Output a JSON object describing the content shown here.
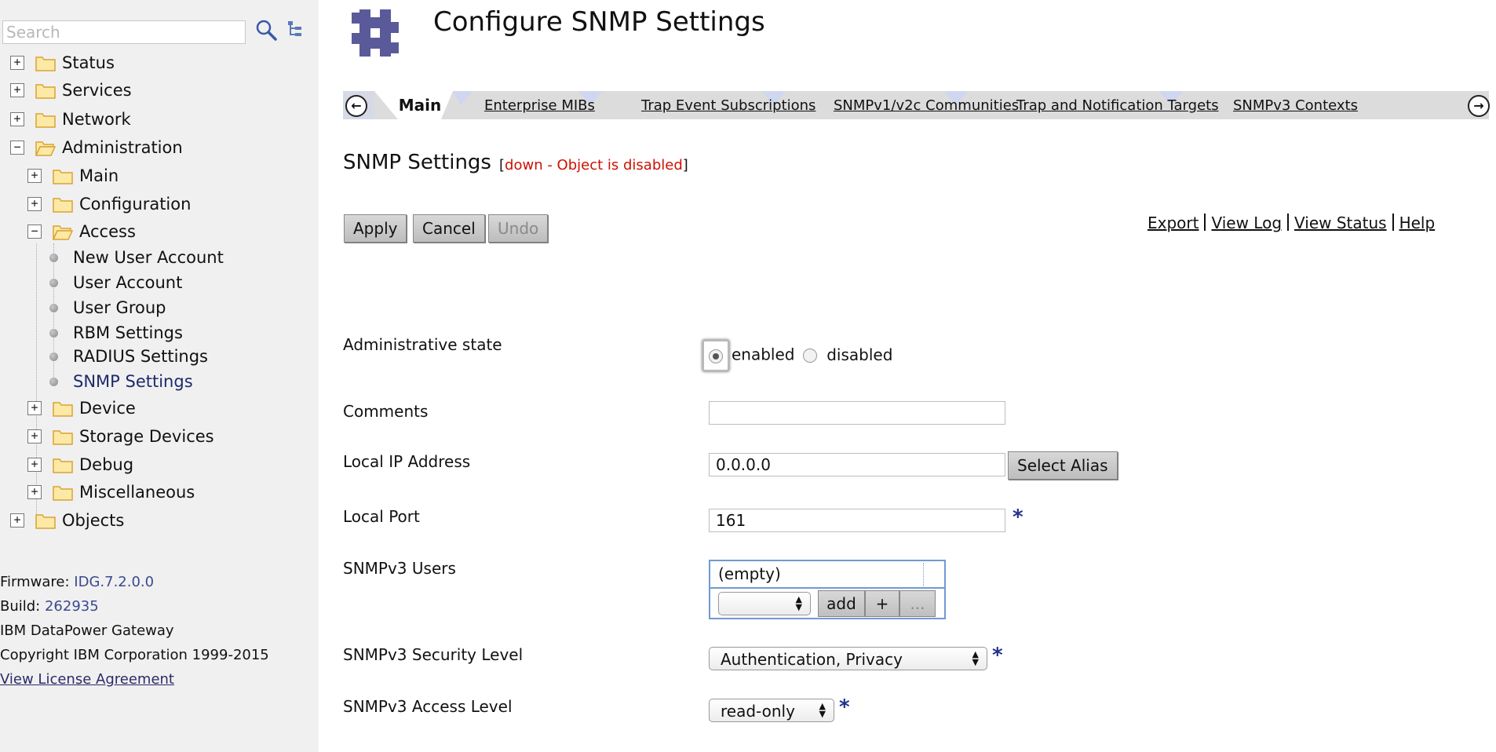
{
  "sidebar": {
    "search": {
      "placeholder": "Search",
      "value": ""
    },
    "tree": {
      "status": "Status",
      "services": "Services",
      "network": "Network",
      "administration": "Administration",
      "main": "Main",
      "configuration": "Configuration",
      "access": "Access",
      "new_user_account": "New User Account",
      "user_account": "User Account",
      "user_group": "User Group",
      "rbm_settings": "RBM Settings",
      "radius_settings": "RADIUS Settings",
      "snmp_settings": "SNMP Settings",
      "device": "Device",
      "storage_devices": "Storage Devices",
      "debug": "Debug",
      "miscellaneous": "Miscellaneous",
      "objects": "Objects"
    },
    "footer": {
      "firmware_label": "Firmware: ",
      "firmware_value": "IDG.7.2.0.0",
      "build_label": "Build: ",
      "build_value": "262935",
      "product": "IBM DataPower Gateway",
      "copyright": "Copyright IBM Corporation 1999-2015",
      "license_link": "View License Agreement"
    }
  },
  "header": {
    "title": "Configure SNMP Settings"
  },
  "tabs": {
    "main": "Main",
    "enterprise_mibs": "Enterprise MIBs",
    "trap_event_subscriptions": "Trap Event Subscriptions",
    "communities": "SNMPv1/v2c Communities",
    "trap_targets": "Trap and Notification Targets",
    "snmpv3_contexts": "SNMPv3 Contexts"
  },
  "section": {
    "title": "SNMP Settings",
    "status_open": "[",
    "status_text": "down - Object is disabled",
    "status_close": "]"
  },
  "actions": {
    "apply": "Apply",
    "cancel": "Cancel",
    "undo": "Undo"
  },
  "links": {
    "export": "Export",
    "view_log": "View Log",
    "view_status": "View Status",
    "help": "Help"
  },
  "form": {
    "admin_state": {
      "label": "Administrative state",
      "enabled": "enabled",
      "disabled": "disabled",
      "selected": "enabled"
    },
    "comments": {
      "label": "Comments",
      "value": ""
    },
    "local_ip": {
      "label": "Local IP Address",
      "value": "0.0.0.0",
      "button": "Select Alias"
    },
    "local_port": {
      "label": "Local Port",
      "value": "161",
      "required": "*"
    },
    "snmpv3_users": {
      "label": "SNMPv3 Users",
      "empty": "(empty)",
      "add": "add",
      "plus": "+",
      "more": "..."
    },
    "security_level": {
      "label": "SNMPv3 Security Level",
      "value": "Authentication, Privacy",
      "required": "*"
    },
    "access_level": {
      "label": "SNMPv3 Access Level",
      "value": "read-only",
      "required": "*"
    }
  },
  "colors": {
    "sidebar_bg": "#f0f0f0",
    "tab_bar": "#dcdcdc",
    "status_red": "#cc1100",
    "required_blue": "#22338a",
    "link_blue": "#3b4a8f"
  },
  "icons": [
    "search-icon",
    "tree-view-icon",
    "folder-icon",
    "folder-open-icon",
    "datapower-logo",
    "arrow-left-icon",
    "arrow-right-icon"
  ]
}
